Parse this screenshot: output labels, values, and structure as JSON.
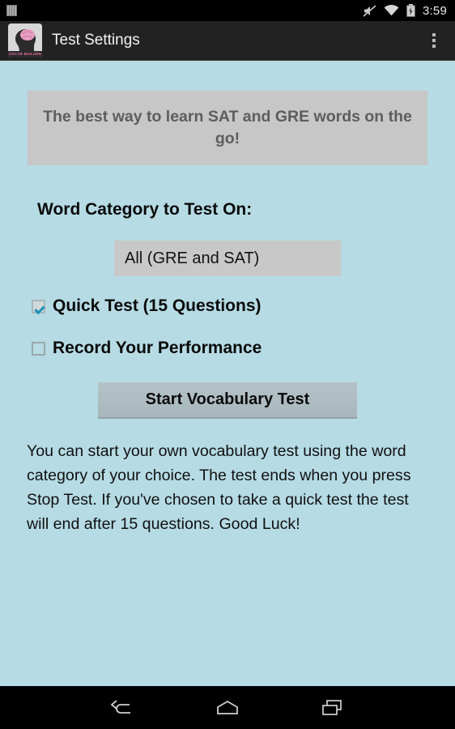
{
  "status_bar": {
    "left_icons": [
      "sim-card-icon"
    ],
    "right_icons": [
      "volume-mute-icon",
      "wifi-icon",
      "battery-charging-icon"
    ],
    "time": "3:59"
  },
  "action_bar": {
    "app_icon": "vocab-builder-brain-icon",
    "app_icon_label": "VOCAB BUILDER",
    "title": "Test Settings",
    "overflow_icon": "more-vertical-icon"
  },
  "banner": {
    "text": "The best way to learn SAT and GRE words on the go!",
    "background": "#c7c7c7",
    "text_color": "#5d5d5d"
  },
  "form": {
    "category_label": "Word Category to Test On:",
    "category_spinner": {
      "selected": "All (GRE and SAT)",
      "options": [
        "All (GRE and SAT)"
      ]
    },
    "checkboxes": [
      {
        "label": "Quick Test (15 Questions)",
        "checked": true
      },
      {
        "label": "Record Your Performance",
        "checked": false
      }
    ],
    "start_button": "Start Vocabulary Test"
  },
  "description": "You can start your own vocabulary test using the word category of your choice. The test ends when you press Stop Test. If you've chosen to take a quick test the test will end after 15 questions. Good Luck!",
  "nav_bar": {
    "back_icon": "back-arrow-icon",
    "home_icon": "home-icon",
    "recents_icon": "recent-apps-icon"
  },
  "colors": {
    "page_background": "#b6dbe4",
    "action_bar": "#222222",
    "accent_check": "#1b90b6",
    "button": "#aebdc2",
    "spinner": "#c8c8c8"
  }
}
